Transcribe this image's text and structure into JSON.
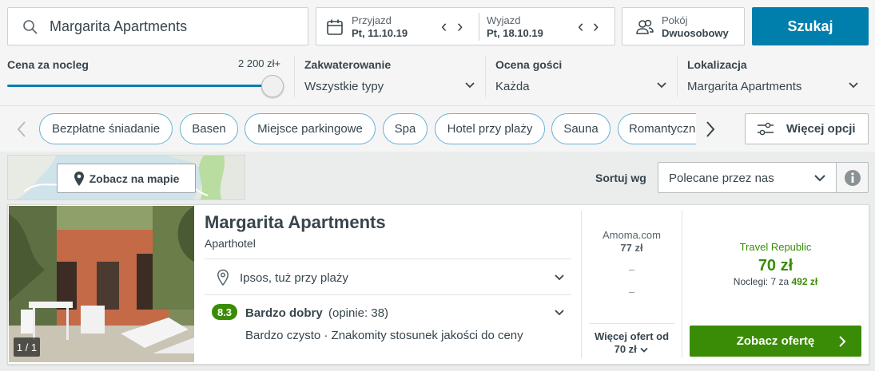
{
  "search": {
    "value": "Margarita Apartments"
  },
  "dates": {
    "checkin_label": "Przyjazd",
    "checkin_value": "Pt, 11.10.19",
    "checkout_label": "Wyjazd",
    "checkout_value": "Pt, 18.10.19"
  },
  "room": {
    "label": "Pokój",
    "value": "Dwuosobowy"
  },
  "search_button": "Szukaj",
  "filters": {
    "price": {
      "label": "Cena za nocleg",
      "max": "2 200 zł+",
      "level_fraction": 1.0
    },
    "accommodation": {
      "label": "Zakwaterowanie",
      "value": "Wszystkie typy"
    },
    "rating": {
      "label": "Ocena gości",
      "value": "Każda"
    },
    "location": {
      "label": "Lokalizacja",
      "value": "Margarita Apartments"
    }
  },
  "chips": [
    "Bezpłatne śniadanie",
    "Basen",
    "Miejsce parkingowe",
    "Spa",
    "Hotel przy plaży",
    "Sauna",
    "Romantyczn"
  ],
  "more_options": "Więcej opcji",
  "map_button": "Zobacz na mapie",
  "sort": {
    "label": "Sortuj wg",
    "value": "Polecane przez nas"
  },
  "hotel": {
    "name": "Margarita Apartments",
    "type": "Aparthotel",
    "location": "Ipsos, tuż przy plaży",
    "photo_counter": "1 / 1",
    "rating_score": "8.3",
    "rating_text": "Bardzo dobry",
    "rating_reviews": "(opinie: 38)",
    "highlights": "Bardzo czysto · Znakomity stosunek jakości do ceny",
    "other_offer": {
      "site": "Amoma.com",
      "price": "77 zł",
      "dash1": "–",
      "dash2": "–"
    },
    "more_offers_line1": "Więcej ofert od",
    "more_offers_line2": "70 zł",
    "best_offer": {
      "site": "Travel Republic",
      "price": "70 zł",
      "nights_prefix": "Noclegi: 7 za",
      "nights_total": "492 zł"
    },
    "offer_button": "Zobacz ofertę"
  },
  "colors": {
    "accent": "#007fad",
    "green": "#3a8c06",
    "chip_border": "#66b2d5"
  }
}
